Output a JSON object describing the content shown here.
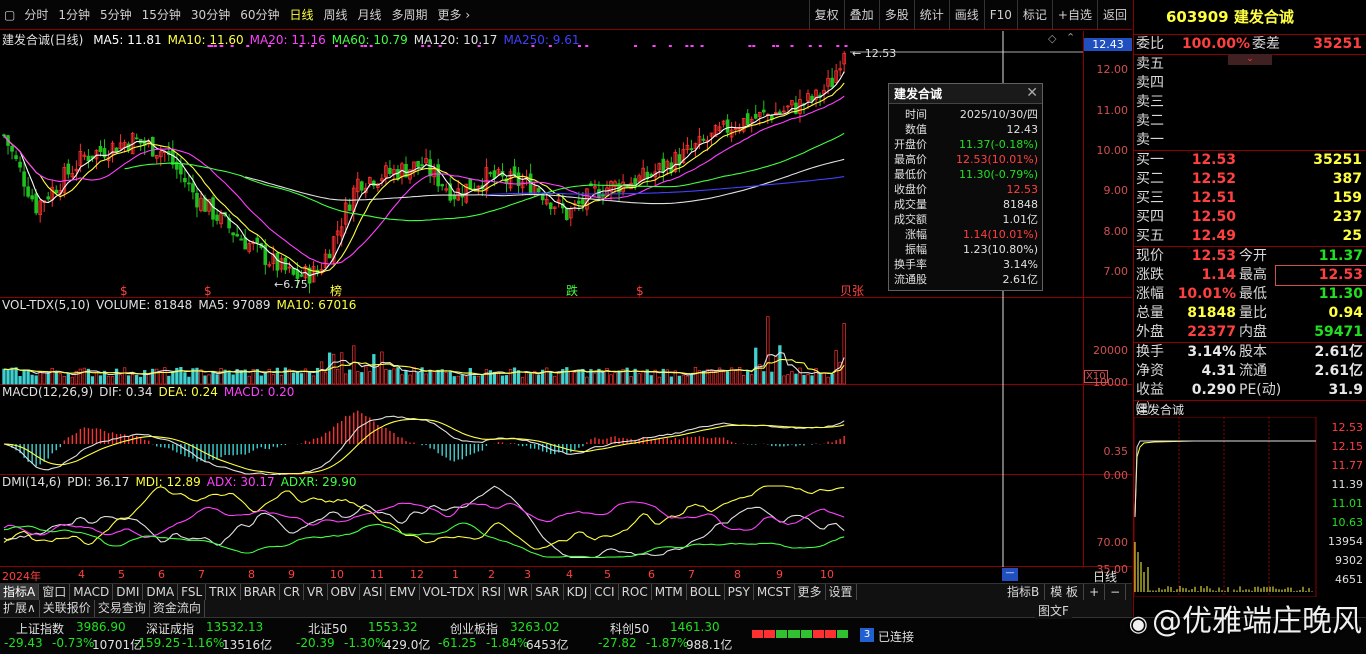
{
  "toolbar": {
    "periods": [
      "分时",
      "1分钟",
      "5分钟",
      "15分钟",
      "30分钟",
      "60分钟",
      "日线",
      "周线",
      "月线",
      "多周期",
      "更多 ›"
    ],
    "active_period": "日线",
    "right_tools": [
      "复权",
      "叠加",
      "多股",
      "统计",
      "画线",
      "F10",
      "标记",
      "+自选",
      "返回"
    ]
  },
  "kline": {
    "title": "建发合诚(日线)",
    "ma": [
      {
        "label": "MA5: 11.81",
        "color": "#ffffff"
      },
      {
        "label": "MA10: 11.60",
        "color": "#ffff40"
      },
      {
        "label": "MA20: 11.16",
        "color": "#ff40ff"
      },
      {
        "label": "MA60: 10.79",
        "color": "#40ff40"
      },
      {
        "label": "MA120: 10.17",
        "color": "#e0e0e0"
      },
      {
        "label": "MA250: 9.61",
        "color": "#4040ff"
      }
    ],
    "current_price_tag": "12.43",
    "high_label": "12.53",
    "low_label": "6.75",
    "yticks": [
      "12.00",
      "11.00",
      "10.00",
      "9.00",
      "8.00",
      "7.00"
    ],
    "markers": [
      {
        "text": "$",
        "color": "#ff4040"
      },
      {
        "text": "$",
        "color": "#ff4040"
      },
      {
        "text": "榜",
        "color": "#ffff40"
      },
      {
        "text": "跌",
        "color": "#40ff40"
      },
      {
        "text": "$",
        "color": "#ff4040"
      },
      {
        "text": "贝张",
        "color": "#ff4040"
      }
    ]
  },
  "tooltip": {
    "title": "建发合诚",
    "rows": [
      {
        "k": "时间",
        "v": "2025/10/30/四",
        "c": "#e0e0e0"
      },
      {
        "k": "数值",
        "v": "12.43",
        "c": "#e0e0e0"
      },
      {
        "k": "开盘价",
        "v": "11.37(-0.18%)",
        "c": "#20e020"
      },
      {
        "k": "最高价",
        "v": "12.53(10.01%)",
        "c": "#ff4040"
      },
      {
        "k": "最低价",
        "v": "11.30(-0.79%)",
        "c": "#20e020"
      },
      {
        "k": "收盘价",
        "v": "12.53",
        "c": "#ff4040"
      },
      {
        "k": "成交量",
        "v": "81848",
        "c": "#e0e0e0"
      },
      {
        "k": "成交额",
        "v": "1.01亿",
        "c": "#e0e0e0"
      },
      {
        "k": "涨幅",
        "v": "1.14(10.01%)",
        "c": "#ff4040"
      },
      {
        "k": "振幅",
        "v": "1.23(10.80%)",
        "c": "#e0e0e0"
      },
      {
        "k": "换手率",
        "v": "3.14%",
        "c": "#e0e0e0"
      },
      {
        "k": "流通股",
        "v": "2.61亿",
        "c": "#e0e0e0"
      }
    ]
  },
  "volume": {
    "title": "VOL-TDX(5,10)",
    "items": [
      {
        "label": "VOLUME: 81848",
        "color": "#e0e0e0"
      },
      {
        "label": "MA5: 97089",
        "color": "#e0e0e0"
      },
      {
        "label": "MA10: 67016",
        "color": "#ffff40"
      }
    ],
    "yticks": [
      "20000",
      "10000"
    ],
    "unit": "X10"
  },
  "macd": {
    "title": "MACD(12,26,9)",
    "items": [
      {
        "label": "DIF: 0.34",
        "color": "#e0e0e0"
      },
      {
        "label": "DEA: 0.24",
        "color": "#ffff40"
      },
      {
        "label": "MACD: 0.20",
        "color": "#ff40ff"
      }
    ],
    "yticks": [
      "0.35",
      "0.00"
    ]
  },
  "dmi": {
    "title": "DMI(14,6)",
    "items": [
      {
        "label": "PDI: 36.17",
        "color": "#e0e0e0"
      },
      {
        "label": "MDI: 12.89",
        "color": "#ffff40"
      },
      {
        "label": "ADX: 30.17",
        "color": "#ff40ff"
      },
      {
        "label": "ADXR: 29.90",
        "color": "#40ff40"
      }
    ],
    "yticks": [
      "70.00",
      "35.00"
    ]
  },
  "xaxis": {
    "year": "2024年",
    "months": [
      "4",
      "5",
      "6",
      "7",
      "8",
      "9",
      "10",
      "11",
      "12",
      "1",
      "2",
      "3",
      "4",
      "5",
      "6",
      "7",
      "8",
      "9",
      "10"
    ],
    "right_label": "日线"
  },
  "tabs1": [
    "指标A",
    "窗口",
    "MACD",
    "DMI",
    "DMA",
    "FSL",
    "TRIX",
    "BRAR",
    "CR",
    "VR",
    "OBV",
    "ASI",
    "EMV",
    "VOL-TDX",
    "RSI",
    "WR",
    "SAR",
    "KDJ",
    "CCI",
    "ROC",
    "MTM",
    "BOLL",
    "PSY",
    "MCST",
    "更多",
    "设置"
  ],
  "tabs1_right": [
    "指标B",
    "模 板",
    "+",
    "−"
  ],
  "tabs2": [
    "扩展∧",
    "关联报价",
    "交易查询",
    "资金流向"
  ],
  "quote": {
    "code": "603909",
    "name": "建发合诚",
    "weibi_label": "委比",
    "weibi": "100.00%",
    "weicha_label": "委差",
    "weicha": "35251",
    "sells": [
      {
        "l": "卖五"
      },
      {
        "l": "卖四"
      },
      {
        "l": "卖三"
      },
      {
        "l": "卖二"
      },
      {
        "l": "卖一"
      }
    ],
    "buys": [
      {
        "l": "买一",
        "p": "12.53",
        "v": "35251"
      },
      {
        "l": "买二",
        "p": "12.52",
        "v": "387"
      },
      {
        "l": "买三",
        "p": "12.51",
        "v": "159"
      },
      {
        "l": "买四",
        "p": "12.50",
        "v": "237"
      },
      {
        "l": "买五",
        "p": "12.49",
        "v": "25"
      }
    ],
    "stats": [
      {
        "l1": "现价",
        "v1": "12.53",
        "c1": "#ff4040",
        "l2": "今开",
        "v2": "11.37",
        "c2": "#20e020"
      },
      {
        "l1": "涨跌",
        "v1": "1.14",
        "c1": "#ff4040",
        "l2": "最高",
        "v2": "12.53",
        "c2": "#ff4040"
      },
      {
        "l1": "涨幅",
        "v1": "10.01%",
        "c1": "#ff4040",
        "l2": "最低",
        "v2": "11.30",
        "c2": "#20e020"
      },
      {
        "l1": "总量",
        "v1": "81848",
        "c1": "#ffff40",
        "l2": "量比",
        "v2": "0.94",
        "c2": "#ffff40"
      },
      {
        "l1": "外盘",
        "v1": "22377",
        "c1": "#ff4040",
        "l2": "内盘",
        "v2": "59471",
        "c2": "#20e020"
      }
    ],
    "stats2": [
      {
        "l1": "换手",
        "v1": "3.14%",
        "c1": "#e8e8e8",
        "l2": "股本",
        "v2": "2.61亿",
        "c2": "#e8e8e8"
      },
      {
        "l1": "净资",
        "v1": "4.31",
        "c1": "#e8e8e8",
        "l2": "流通",
        "v2": "2.61亿",
        "c2": "#e8e8e8"
      },
      {
        "l1": "收益㈢",
        "v1": "0.290",
        "c1": "#e8e8e8",
        "l2": "PE(动)",
        "v2": "31.9",
        "c2": "#e8e8e8"
      }
    ],
    "mini_title": "建发合诚",
    "mini_yticks": [
      {
        "t": "12.53",
        "c": "#ff4040"
      },
      {
        "t": "12.15",
        "c": "#ff4040"
      },
      {
        "t": "11.77",
        "c": "#ff4040"
      },
      {
        "t": "11.39",
        "c": "#e0e0e0"
      },
      {
        "t": "11.01",
        "c": "#20e020"
      },
      {
        "t": "10.63",
        "c": "#20e020"
      },
      {
        "t": "13954",
        "c": "#e0e0e0"
      },
      {
        "t": "9302",
        "c": "#e0e0e0"
      },
      {
        "t": "4651",
        "c": "#e0e0e0"
      }
    ]
  },
  "status": {
    "indices": [
      {
        "name": "上证指数",
        "val": "3986.90",
        "chg": "-29.43",
        "pct": "-0.73%",
        "amt": "10701亿"
      },
      {
        "name": "深证成指",
        "val": "13532.13",
        "chg": "-159.25",
        "pct": "-1.16%",
        "amt": "13516亿"
      },
      {
        "name": "北证50",
        "val": "1553.32",
        "chg": "-20.39",
        "pct": "-1.30%",
        "amt": "429.0亿"
      },
      {
        "name": "创业板指",
        "val": "3263.02",
        "chg": "-61.25",
        "pct": "-1.84%",
        "amt": "6453亿"
      },
      {
        "name": "科创50",
        "val": "1461.30",
        "chg": "-27.82",
        "pct": "-1.87%",
        "amt": "988.1亿"
      }
    ],
    "conn_count": "3",
    "conn_text": "已连接",
    "tail_label": "图文F",
    "watermark": "@优雅端庄晚风"
  }
}
